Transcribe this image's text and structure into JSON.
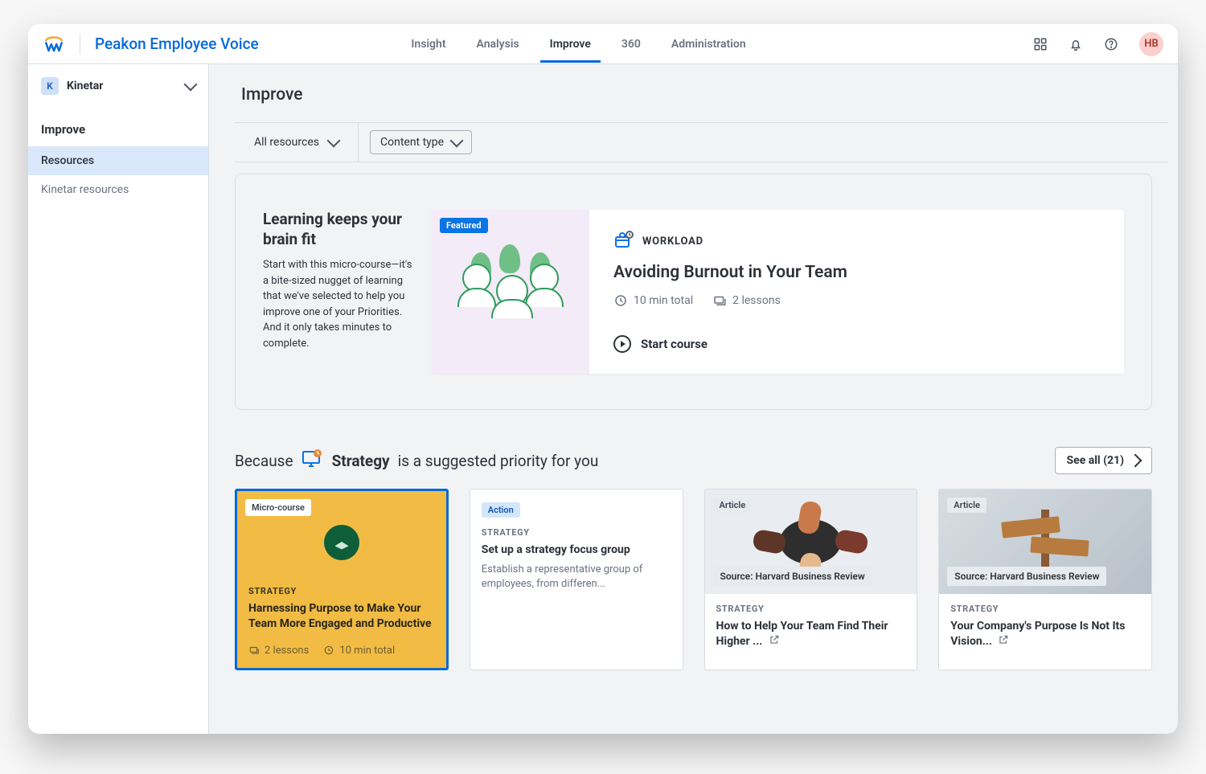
{
  "brand": {
    "name": "Peakon Employee Voice"
  },
  "nav": {
    "items": [
      {
        "label": "Insight"
      },
      {
        "label": "Analysis"
      },
      {
        "label": "Improve",
        "active": true
      },
      {
        "label": "360"
      },
      {
        "label": "Administration"
      }
    ]
  },
  "avatar_initials": "HB",
  "org": {
    "initial": "K",
    "name": "Kinetar"
  },
  "sidebar": {
    "section_label": "Improve",
    "items": [
      {
        "label": "Resources",
        "active": true
      },
      {
        "label": "Kinetar resources"
      }
    ]
  },
  "page": {
    "title": "Improve"
  },
  "filters": {
    "all_label": "All resources",
    "content_type_label": "Content type"
  },
  "hero": {
    "headline": "Learning keeps your brain fit",
    "subtext": "Start with this micro-course—it's a bite-sized nugget of learning that we've selected to help you improve one of your Priorities. And it only takes minutes to complete.",
    "featured_badge": "Featured",
    "category": "WORKLOAD",
    "title": "Avoiding Burnout in Your Team",
    "duration": "10 min total",
    "lessons": "2 lessons",
    "cta": "Start course"
  },
  "suggested": {
    "prefix": "Because",
    "priority_name": "Strategy",
    "suffix": "is a suggested priority for you",
    "see_all_label": "See all (21)"
  },
  "cards": [
    {
      "type_label": "Micro-course",
      "category": "STRATEGY",
      "title": "Harnessing Purpose to Make Your Team More Engaged and Productive",
      "lessons": "2 lessons",
      "duration": "10 min total"
    },
    {
      "type_label": "Action",
      "category": "STRATEGY",
      "title": "Set up a strategy focus group",
      "desc": "Establish a representative group of employees, from differen..."
    },
    {
      "type_label": "Article",
      "source": "Source: Harvard Business Review",
      "category": "STRATEGY",
      "title": "How to Help Your Team Find Their Higher ..."
    },
    {
      "type_label": "Article",
      "source": "Source: Harvard Business Review",
      "category": "STRATEGY",
      "title": "Your Company's Purpose Is Not Its Vision..."
    }
  ]
}
